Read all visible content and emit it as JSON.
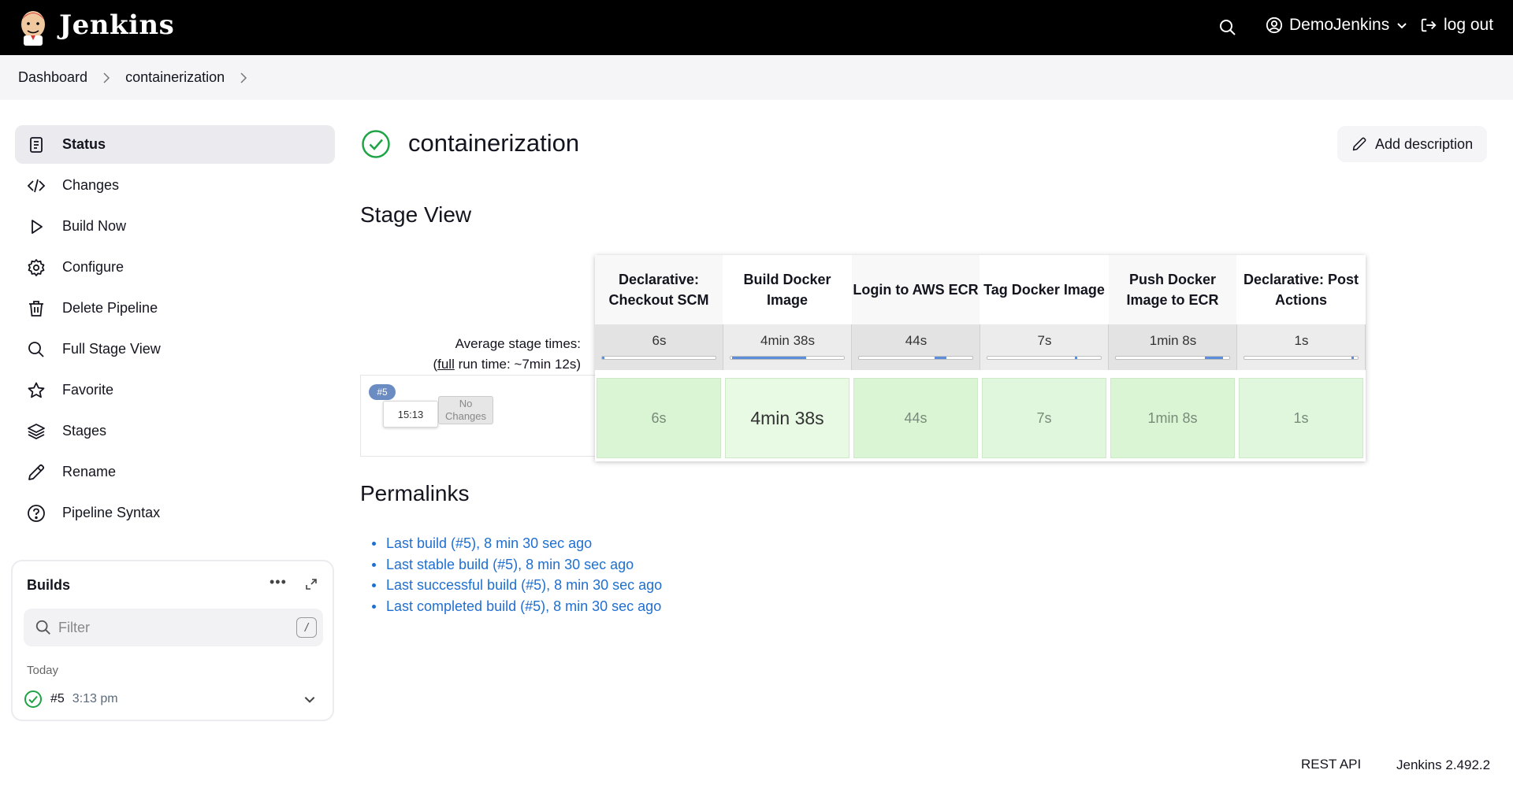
{
  "header": {
    "brand": "Jenkins",
    "user": "DemoJenkins",
    "logout": "log out"
  },
  "breadcrumb": [
    "Dashboard",
    "containerization"
  ],
  "sidebar": {
    "items": [
      {
        "label": "Status",
        "icon": "status-icon",
        "active": true
      },
      {
        "label": "Changes",
        "icon": "code-icon"
      },
      {
        "label": "Build Now",
        "icon": "play-icon"
      },
      {
        "label": "Configure",
        "icon": "gear-icon"
      },
      {
        "label": "Delete Pipeline",
        "icon": "trash-icon"
      },
      {
        "label": "Full Stage View",
        "icon": "search-icon"
      },
      {
        "label": "Favorite",
        "icon": "star-icon"
      },
      {
        "label": "Stages",
        "icon": "layers-icon"
      },
      {
        "label": "Rename",
        "icon": "pencil-icon"
      },
      {
        "label": "Pipeline Syntax",
        "icon": "help-icon"
      }
    ]
  },
  "builds": {
    "title": "Builds",
    "filter_placeholder": "Filter",
    "filter_shortcut": "/",
    "group": "Today",
    "items": [
      {
        "number": "#5",
        "time": "3:13 pm"
      }
    ]
  },
  "main": {
    "title": "containerization",
    "add_description": "Add description",
    "stage_view_heading": "Stage View",
    "permalinks_heading": "Permalinks"
  },
  "stage_view": {
    "avg_label": "Average stage times:",
    "full_run_prefix": "(",
    "full_link": "full",
    "full_run_suffix": " run time: ~7min 12s)",
    "run": {
      "badge": "#5",
      "time": "15:13",
      "changes": "No Changes"
    },
    "stages": [
      {
        "name": "Declarative: Checkout SCM",
        "avg": "6s",
        "cell": "6s",
        "avg_start": 0.0,
        "avg_fraction": 0.014
      },
      {
        "name": "Build Docker Image",
        "avg": "4min 38s",
        "cell": "4min 38s",
        "avg_start": 0.014,
        "avg_fraction": 0.643
      },
      {
        "name": "Login to AWS ECR",
        "avg": "44s",
        "cell": "44s",
        "avg_start": 0.657,
        "avg_fraction": 0.102
      },
      {
        "name": "Tag Docker Image",
        "avg": "7s",
        "cell": "7s",
        "avg_start": 0.759,
        "avg_fraction": 0.016
      },
      {
        "name": "Push Docker Image to ECR",
        "avg": "1min 8s",
        "cell": "1min 8s",
        "avg_start": 0.775,
        "avg_fraction": 0.157
      },
      {
        "name": "Declarative: Post Actions",
        "avg": "1s",
        "cell": "1s",
        "avg_start": 0.932,
        "avg_fraction": 0.002
      }
    ]
  },
  "permalinks": [
    "Last build (#5), 8 min 30 sec ago",
    "Last stable build (#5), 8 min 30 sec ago",
    "Last successful build (#5), 8 min 30 sec ago",
    "Last completed build (#5), 8 min 30 sec ago"
  ],
  "footer": {
    "rest_api": "REST API",
    "version": "Jenkins 2.492.2"
  },
  "colors": {
    "success": "#1ea446",
    "link": "#1f6fd1",
    "stage_success": "#dff6da"
  }
}
